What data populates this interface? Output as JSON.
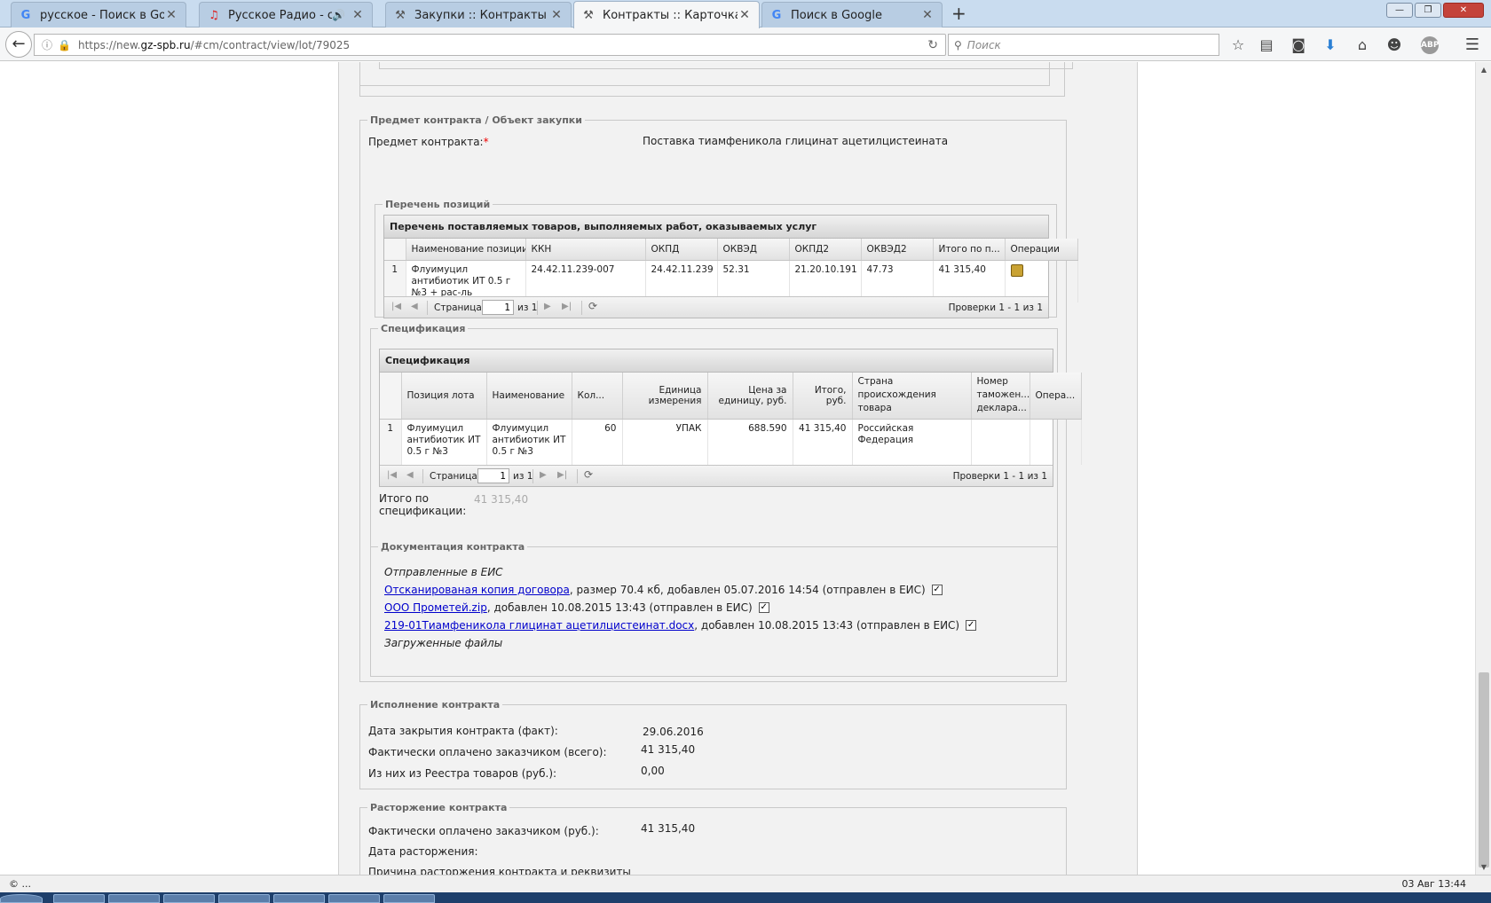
{
  "browser": {
    "tabs": [
      {
        "title": "русское - Поиск в Google",
        "icon": "google-icon"
      },
      {
        "title": "Русское Радио - слуш...",
        "icon": "radio-icon"
      },
      {
        "title": "Закупки :: Контракты на э...",
        "icon": "hammer-icon"
      },
      {
        "title": "Контракты :: Карточка ко...",
        "icon": "hammer-icon"
      },
      {
        "title": "Поиск в Google",
        "icon": "google-icon"
      }
    ],
    "active_tab": 3,
    "url_prefix": "https://new.",
    "url_domain": "gz-spb.ru",
    "url_path": "/#cm/contract/view/lot/79025",
    "search_placeholder": "Поиск",
    "adblock_label": "ABP"
  },
  "subject_section": {
    "legend": "Предмет контракта / Объект закупки",
    "label": "Предмет контракта:",
    "required_mark": "*",
    "value": "Поставка тиамфеникола глицинат ацетилцистеината"
  },
  "positions": {
    "legend": "Перечень позиций",
    "grid_title": "Перечень поставляемых товаров, выполняемых работ, оказываемых услуг",
    "columns": [
      "Наименование позиции",
      "ККН",
      "ОКПД",
      "ОКВЭД",
      "ОКПД2",
      "ОКВЭД2",
      "Итого по п...",
      "Операции"
    ],
    "rows": [
      {
        "n": "1",
        "name": "Флуимуцил антибиотик ИТ 0.5 г №3 + рас-ль",
        "kkn": "24.42.11.239-007",
        "okpd": "24.42.11.239",
        "okved": "52.31",
        "okpd2": "21.20.10.191",
        "okved2": "47.73",
        "total": "41 315,40"
      }
    ],
    "pager": {
      "page_label": "Страница",
      "page": "1",
      "of": "из 1",
      "status": "Проверки 1 - 1 из 1"
    }
  },
  "spec": {
    "legend": "Спецификация",
    "grid_title": "Спецификация",
    "columns": [
      "Позиция лота",
      "Наименование",
      "Кол...",
      "Единица измерения",
      "Цена за единицу, руб.",
      "Итого, руб.",
      "Страна происхождения товара",
      "Номер таможен... деклара...",
      "Опера..."
    ],
    "rows": [
      {
        "n": "1",
        "lot": "Флуимуцил антибиотик ИТ 0.5 г №3",
        "name": "Флуимуцил антибиотик ИТ 0.5 г №3",
        "qty": "60",
        "unit": "УПАК",
        "price": "688.590",
        "total": "41 315,40",
        "country": "Российская Федерация",
        "customs": "",
        "ops": ""
      }
    ],
    "pager": {
      "page_label": "Страница",
      "page": "1",
      "of": "из 1",
      "status": "Проверки 1 - 1 из 1"
    },
    "total_label": "Итого по спецификации:",
    "total_value": "41 315,40"
  },
  "docs": {
    "legend": "Документация контракта",
    "sent_heading": "Отправленные в ЕИС",
    "files": [
      {
        "link": "Отсканированая копия договора",
        "info": ", размер 70.4 кб, добавлен 05.07.2016 14:54 (отправлен в ЕИС)"
      },
      {
        "link": "ООО Прометей.zip",
        "info": ", добавлен 10.08.2015 13:43 (отправлен в ЕИС)"
      },
      {
        "link": "219-01Тиамфеникола глицинат ацетилцистеинат.docx",
        "info": ", добавлен 10.08.2015 13:43 (отправлен в ЕИС)"
      }
    ],
    "uploaded_heading": "Загруженные файлы"
  },
  "execution": {
    "legend": "Исполнение контракта",
    "close_date_label": "Дата закрытия контракта (факт):",
    "close_date": "29.06.2016",
    "paid_label": "Фактически оплачено заказчиком (всего):",
    "paid": "41 315,40",
    "registry_label": "Из них из Реестра товаров (руб.):",
    "registry": "0,00"
  },
  "termination": {
    "legend": "Расторжение контракта",
    "paid_label": "Фактически оплачено заказчиком (руб.):",
    "paid": "41 315,40",
    "date_label": "Дата расторжения:",
    "reason_label": "Причина расторжения контракта и реквизиты"
  },
  "statusbar": {
    "left": "© ...",
    "right": "03 Авг 13:44"
  }
}
